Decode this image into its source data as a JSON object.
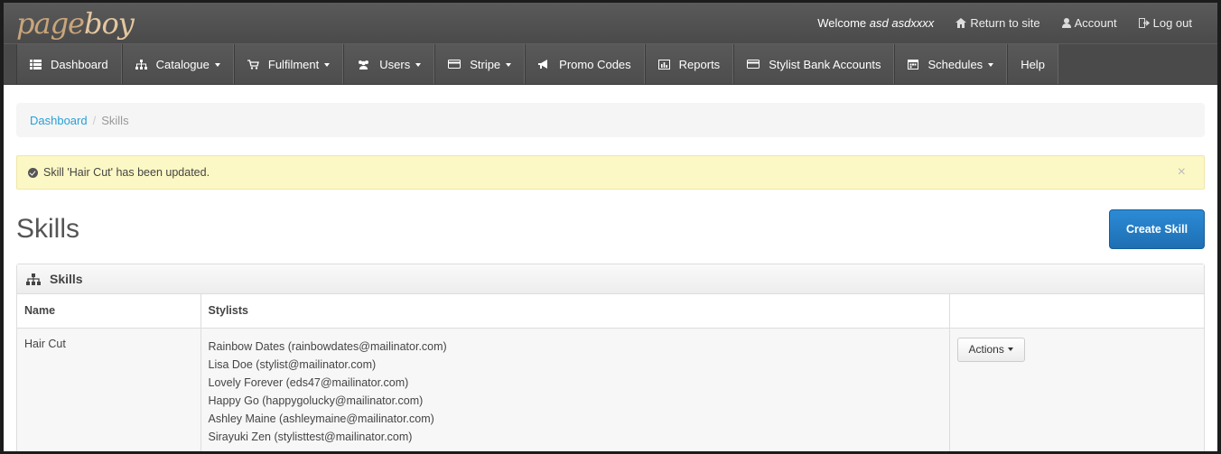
{
  "brand": {
    "logo_a": "page",
    "logo_b": "boy"
  },
  "topnav": {
    "welcome_prefix": "Welcome",
    "user": "asd asdxxxx",
    "return": "Return to site",
    "account": "Account",
    "logout": "Log out"
  },
  "nav": [
    {
      "label": "Dashboard",
      "icon": "list-icon",
      "caret": false
    },
    {
      "label": "Catalogue",
      "icon": "sitemap-icon",
      "caret": true
    },
    {
      "label": "Fulfilment",
      "icon": "cart-icon",
      "caret": true
    },
    {
      "label": "Users",
      "icon": "users-icon",
      "caret": true
    },
    {
      "label": "Stripe",
      "icon": "card-icon",
      "caret": true
    },
    {
      "label": "Promo Codes",
      "icon": "bullhorn-icon",
      "caret": false
    },
    {
      "label": "Reports",
      "icon": "chart-icon",
      "caret": false
    },
    {
      "label": "Stylist Bank Accounts",
      "icon": "card-icon",
      "caret": false
    },
    {
      "label": "Schedules",
      "icon": "calendar-icon",
      "caret": true
    },
    {
      "label": "Help",
      "icon": "",
      "caret": false
    }
  ],
  "breadcrumb": {
    "home": "Dashboard",
    "sep": "/",
    "current": "Skills"
  },
  "alert": {
    "message": "Skill 'Hair Cut' has been updated.",
    "close": "×"
  },
  "page": {
    "title": "Skills",
    "create_button": "Create Skill"
  },
  "panel": {
    "title": "Skills",
    "columns": [
      "Name",
      "Stylists",
      ""
    ],
    "rows": [
      {
        "name": "Hair Cut",
        "stylists": [
          "Rainbow Dates (rainbowdates@mailinator.com)",
          "Lisa Doe (stylist@mailinator.com)",
          "Lovely Forever (eds47@mailinator.com)",
          "Happy Go (happygolucky@mailinator.com)",
          "Ashley Maine (ashleymaine@mailinator.com)",
          "Sirayuki Zen (stylisttest@mailinator.com)"
        ],
        "action": "Actions"
      }
    ]
  },
  "colors": {
    "accent": "#2a9fd6",
    "primary_button": "#1e6fb3",
    "alert_bg": "#fcf8c5",
    "nav_bg": "#4a4a4a"
  }
}
